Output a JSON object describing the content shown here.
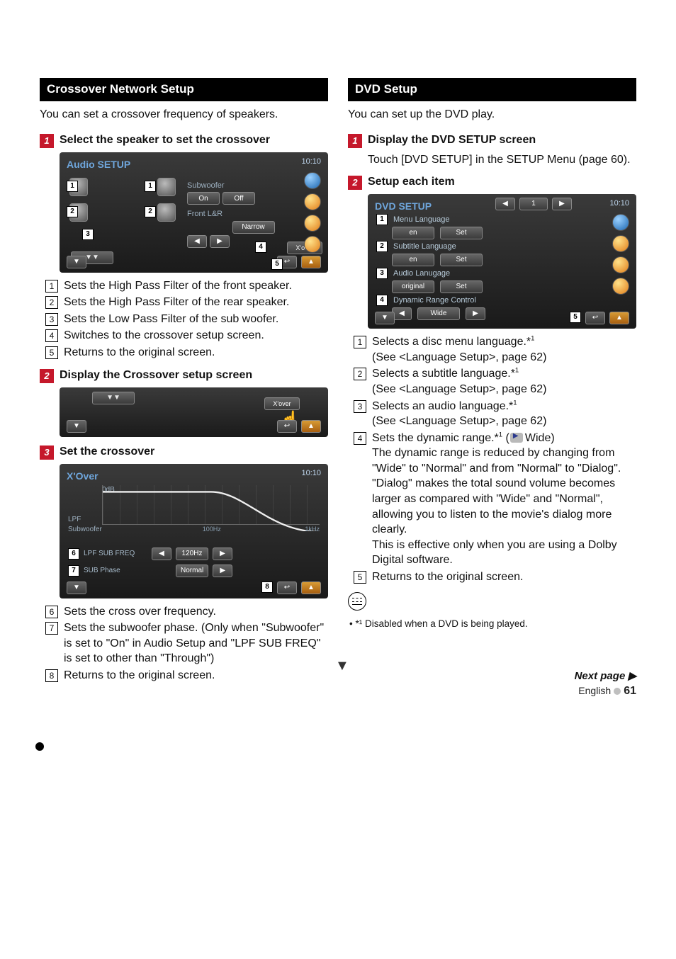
{
  "left": {
    "section_title": "Crossover Network Setup",
    "intro": "You can set a crossover frequency of speakers.",
    "step1": {
      "num": "1",
      "title": "Select the speaker to set the crossover",
      "shot": {
        "title": "Audio SETUP",
        "clock": "10:10",
        "subwoofer_label": "Subwoofer",
        "on": "On",
        "off": "Off",
        "front_label": "Front L&R",
        "narrow": "Narrow",
        "xover_btn": "X'over"
      },
      "callouts": {
        "c1": "Sets the High Pass Filter of the front speaker.",
        "c2": "Sets the High Pass Filter of the rear speaker.",
        "c3": "Sets the Low Pass Filter of the sub woofer.",
        "c4": "Switches to the crossover setup screen.",
        "c5": "Returns to the original screen."
      }
    },
    "step2": {
      "num": "2",
      "title": "Display the Crossover setup screen",
      "shot": {
        "xover_btn": "X'over"
      }
    },
    "step3": {
      "num": "3",
      "title": "Set the crossover",
      "shot": {
        "title": "X'Over",
        "clock": "10:10",
        "gain_label": "0dB",
        "lpf_label": "LPF",
        "sub_label": "Subwoofer",
        "axis_100": "100Hz",
        "axis_1k": "1kHz",
        "row_freq_label": "LPF SUB FREQ",
        "row_freq_value": "120Hz",
        "row_phase_label": "SUB Phase",
        "row_phase_value": "Normal"
      },
      "callouts": {
        "c6": "Sets the cross over frequency.",
        "c7": "Sets the subwoofer phase. (Only when \"Subwoofer\" is set to \"On\" in Audio Setup and \"LPF SUB FREQ\" is set to other than \"Through\")",
        "c8": "Returns to the original screen."
      }
    }
  },
  "right": {
    "section_title": "DVD Setup",
    "intro": "You can set up the DVD play.",
    "step1": {
      "num": "1",
      "title": "Display the DVD SETUP screen",
      "body": "Touch [DVD SETUP] in the SETUP Menu (page 60)."
    },
    "step2": {
      "num": "2",
      "title": "Setup each item",
      "shot": {
        "title": "DVD SETUP",
        "clock": "10:10",
        "row_menu": "Menu Language",
        "row_menu_val": "en",
        "row_sub": "Subtitle Language",
        "row_sub_val": "en",
        "row_aud": "Audio Lanugage",
        "row_aud_val": "original",
        "row_dyn": "Dynamic Range Control",
        "row_dyn_val": "Wide",
        "set_btn": "Set",
        "pager": "1"
      },
      "callouts": {
        "c1a": "Selects a disc menu language.*",
        "c1b": "(See <Language Setup>, page 62)",
        "c2a": "Selects a subtitle language.*",
        "c2b": "(See <Language Setup>, page 62)",
        "c3a": "Selects an audio language.*",
        "c3b": "(See <Language Setup>, page 62)",
        "c4a": "Sets the dynamic range.*",
        "c4b": "Wide)",
        "c4c": "The dynamic range is reduced by changing from \"Wide\" to \"Normal\" and from \"Normal\" to \"Dialog\". \"Dialog\" makes the total sound volume becomes larger as compared with \"Wide\" and \"Normal\", allowing you to listen to the movie's dialog more clearly.",
        "c4d": "This is effective only when you are using a Dolby Digital software.",
        "c5": "Returns to the original screen."
      }
    },
    "note": "*¹ Disabled when a DVD is being played."
  },
  "footer": {
    "next": "Next page ",
    "arrow": "▶",
    "lang": "English",
    "page": "61"
  },
  "nums": {
    "n1": "1",
    "n2": "2",
    "n3": "3",
    "n4": "4",
    "n5": "5",
    "n6": "6",
    "n7": "7",
    "n8": "8"
  },
  "sup1": "1"
}
